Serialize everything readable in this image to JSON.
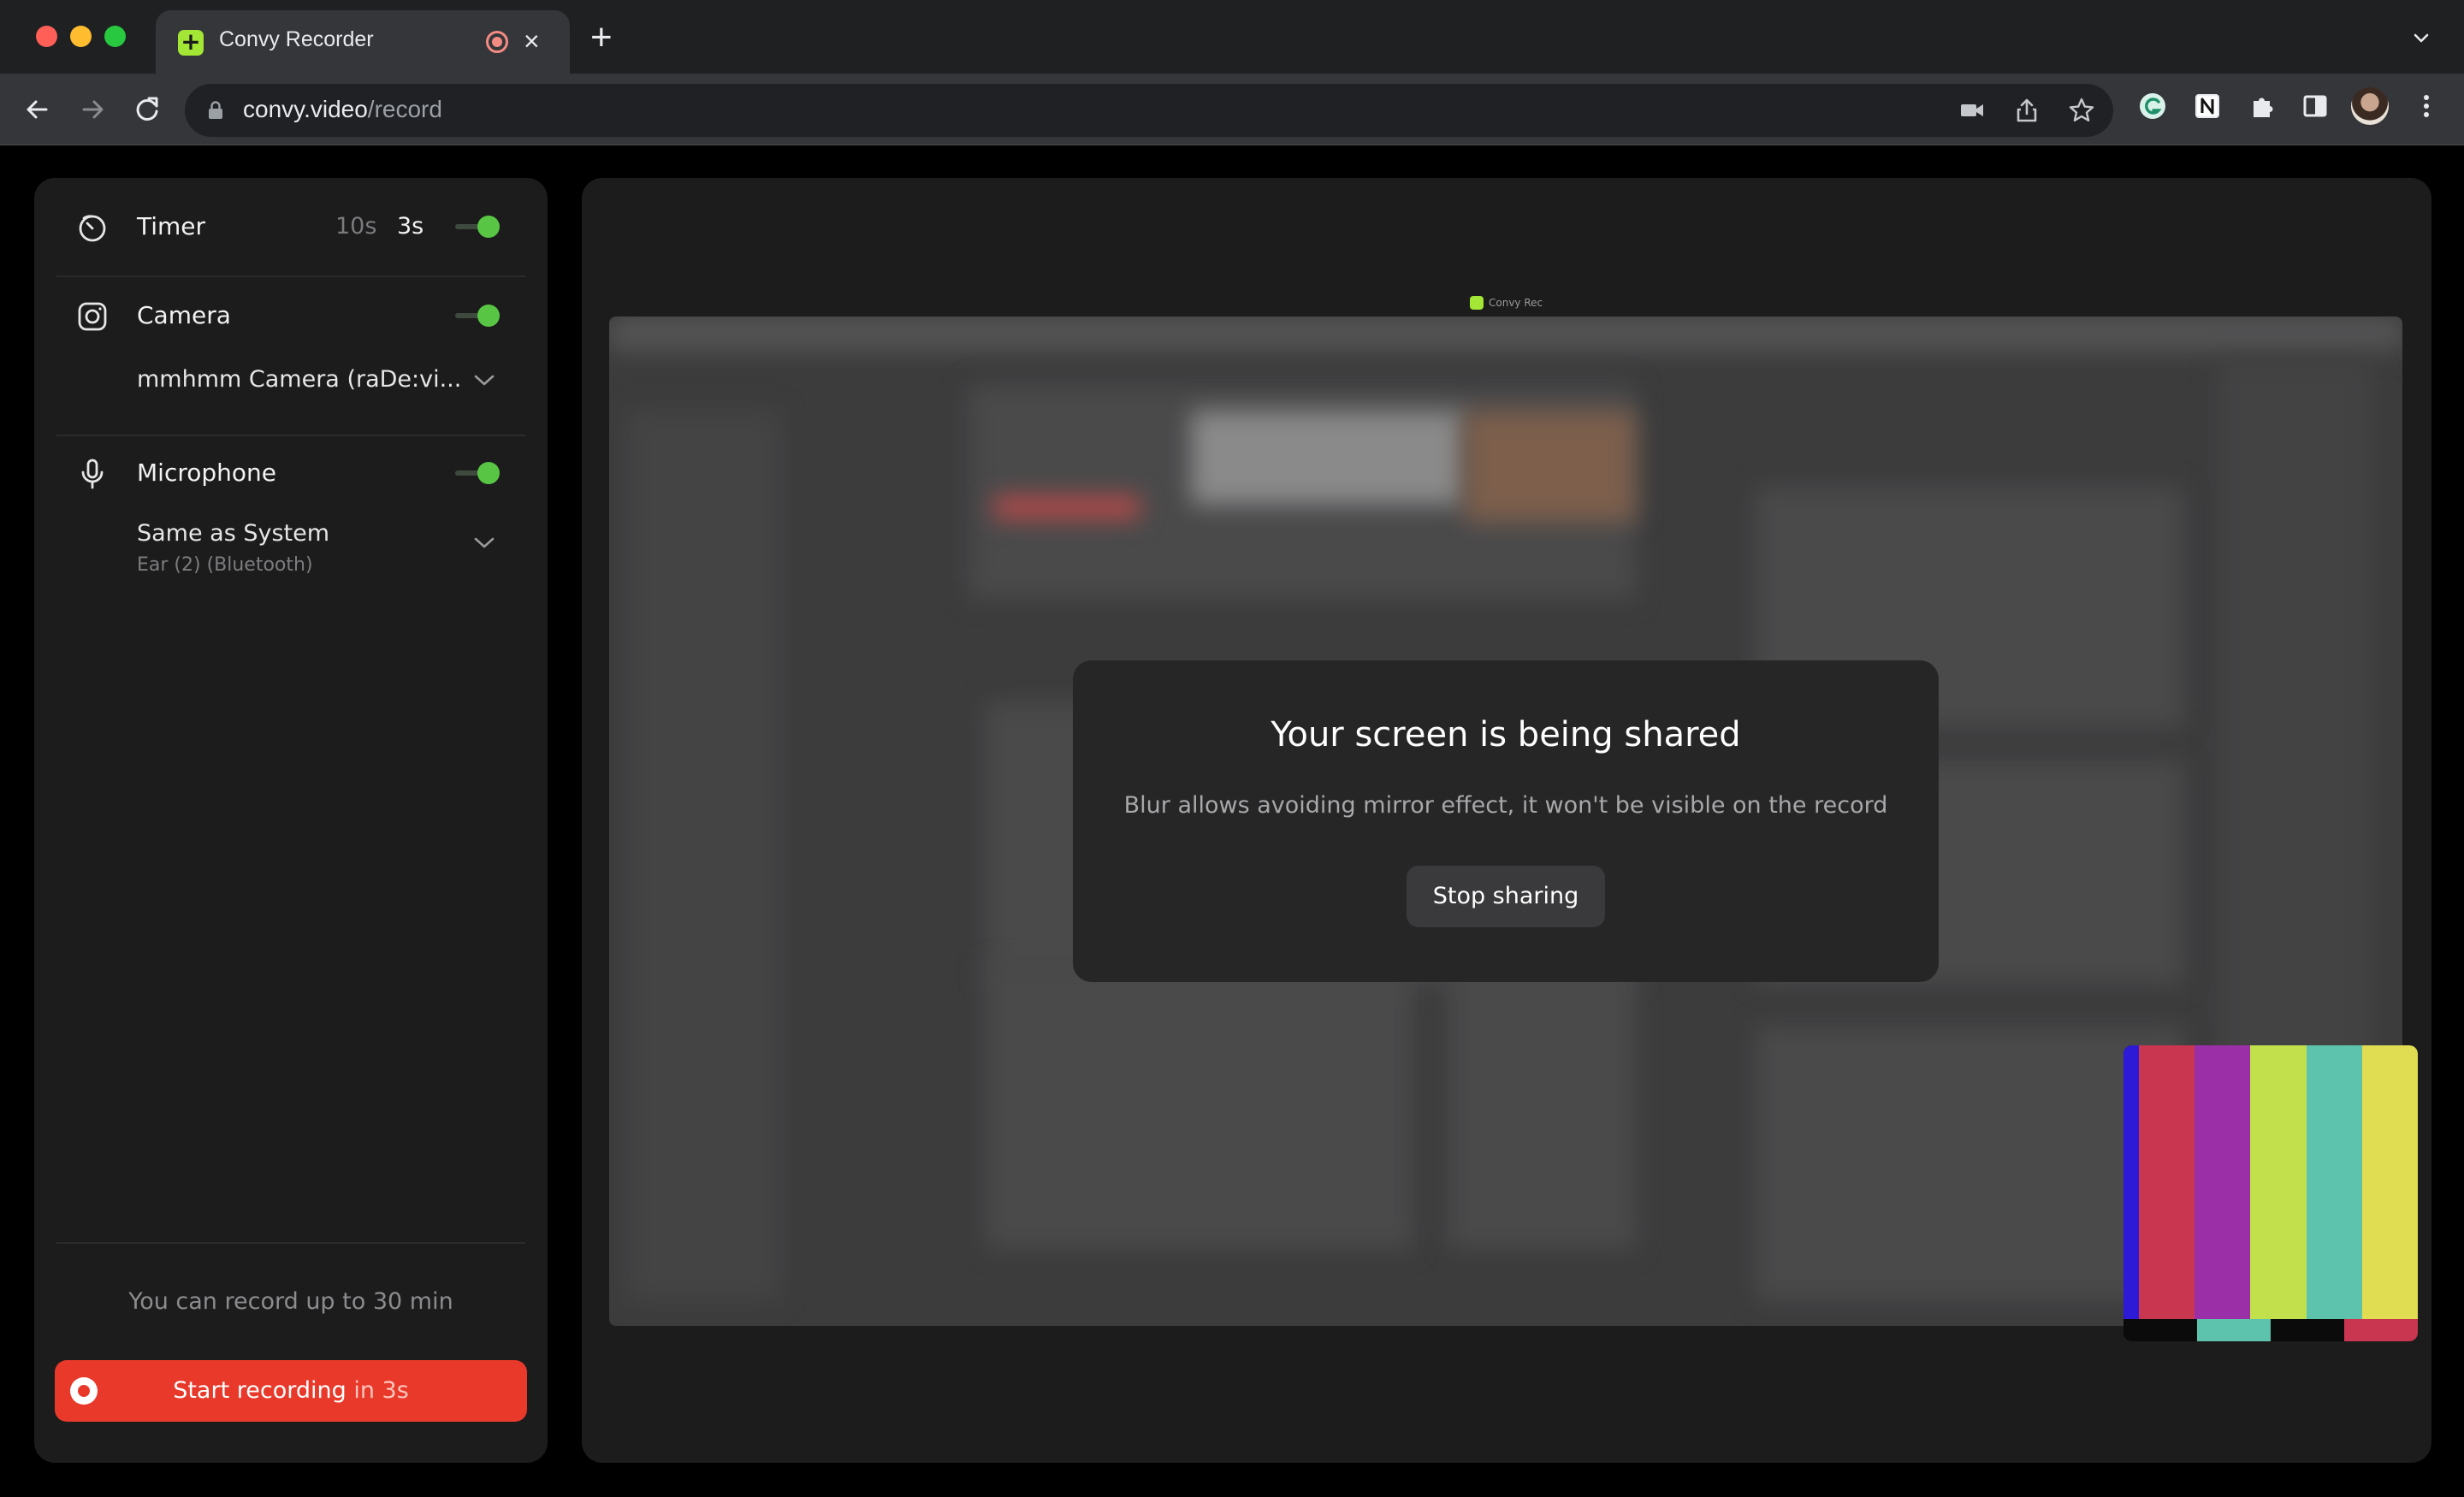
{
  "browser": {
    "tab_title": "Convy Recorder",
    "tab_close": "×",
    "new_tab": "+",
    "favicon_glyph": "+",
    "url_host": "convy.video",
    "url_path": "/record"
  },
  "panel": {
    "timer": {
      "label": "Timer",
      "option_10s": "10s",
      "option_3s": "3s",
      "enabled": true
    },
    "camera": {
      "label": "Camera",
      "device": "mmhmm Camera (raDe:vi...",
      "enabled": true
    },
    "microphone": {
      "label": "Microphone",
      "device": "Same as System",
      "device_sub": "Ear (2) (Bluetooth)",
      "enabled": true
    },
    "limit_text": "You can record up to 30 min",
    "record_button": {
      "label": "Start recording",
      "suffix": " in 3s"
    }
  },
  "preview": {
    "shared_caption": "Convy Rec",
    "modal_title": "Your screen is being shared",
    "modal_subtitle": "Blur allows avoiding mirror effect, it won't be visible on the record",
    "stop_button": "Stop sharing",
    "camera_bar_colors": [
      "#c8364f",
      "#9b2fa8",
      "#c1e04c",
      "#5ec3ac",
      "#e1dd52"
    ],
    "camera_sub_colors": [
      "#0b0b0b",
      "#5ec3ac",
      "#0b0b0b",
      "#c8364f"
    ]
  },
  "colors": {
    "accent_green": "#58c644",
    "record_red": "#e8392a"
  }
}
